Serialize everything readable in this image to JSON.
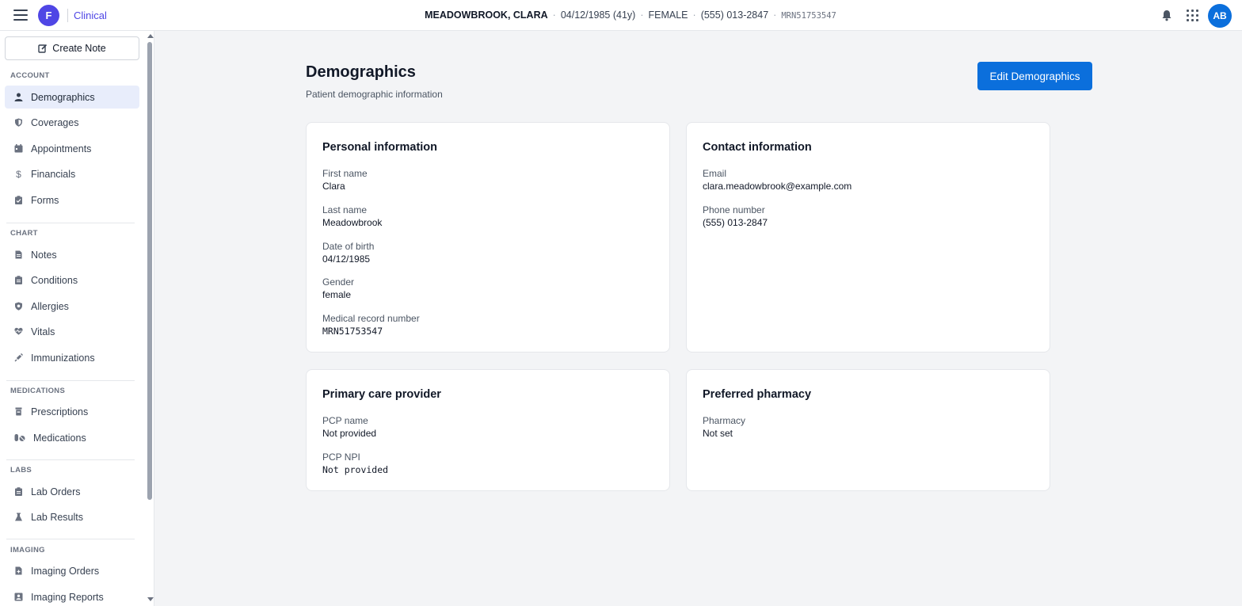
{
  "header": {
    "logo_letter": "F",
    "brand": "Clinical",
    "patient_name": "MEADOWBROOK, CLARA",
    "dob_age": "04/12/1985 (41y)",
    "sex": "FEMALE",
    "phone": "(555) 013-2847",
    "mrn": "MRN51753547",
    "avatar_initials": "AB"
  },
  "sidebar": {
    "create_note": "Create Note",
    "sections": {
      "account": "ACCOUNT",
      "chart": "CHART",
      "medications": "MEDICATIONS",
      "labs": "LABS",
      "imaging": "IMAGING"
    },
    "items": {
      "demographics": "Demographics",
      "coverages": "Coverages",
      "appointments": "Appointments",
      "financials": "Financials",
      "forms": "Forms",
      "notes": "Notes",
      "conditions": "Conditions",
      "allergies": "Allergies",
      "vitals": "Vitals",
      "immunizations": "Immunizations",
      "prescriptions": "Prescriptions",
      "medications": "Medications",
      "lab_orders": "Lab Orders",
      "lab_results": "Lab Results",
      "imaging_orders": "Imaging Orders",
      "imaging_reports": "Imaging Reports"
    },
    "active": "demographics"
  },
  "main": {
    "title": "Demographics",
    "subtitle": "Patient demographic information",
    "edit_button": "Edit Demographics",
    "personal": {
      "title": "Personal information",
      "first_name_label": "First name",
      "first_name": "Clara",
      "last_name_label": "Last name",
      "last_name": "Meadowbrook",
      "dob_label": "Date of birth",
      "dob": "04/12/1985",
      "gender_label": "Gender",
      "gender": "female",
      "mrn_label": "Medical record number",
      "mrn": "MRN51753547"
    },
    "contact": {
      "title": "Contact information",
      "email_label": "Email",
      "email": "clara.meadowbrook@example.com",
      "phone_label": "Phone number",
      "phone": "(555) 013-2847"
    },
    "pcp": {
      "title": "Primary care provider",
      "name_label": "PCP name",
      "name": "Not provided",
      "npi_label": "PCP NPI",
      "npi": "Not provided"
    },
    "pharmacy": {
      "title": "Preferred pharmacy",
      "label": "Pharmacy",
      "value": "Not set"
    }
  },
  "colors": {
    "primary": "#0b6fdc",
    "brand": "#4f46e5",
    "active_nav_bg": "#e8edfb"
  }
}
